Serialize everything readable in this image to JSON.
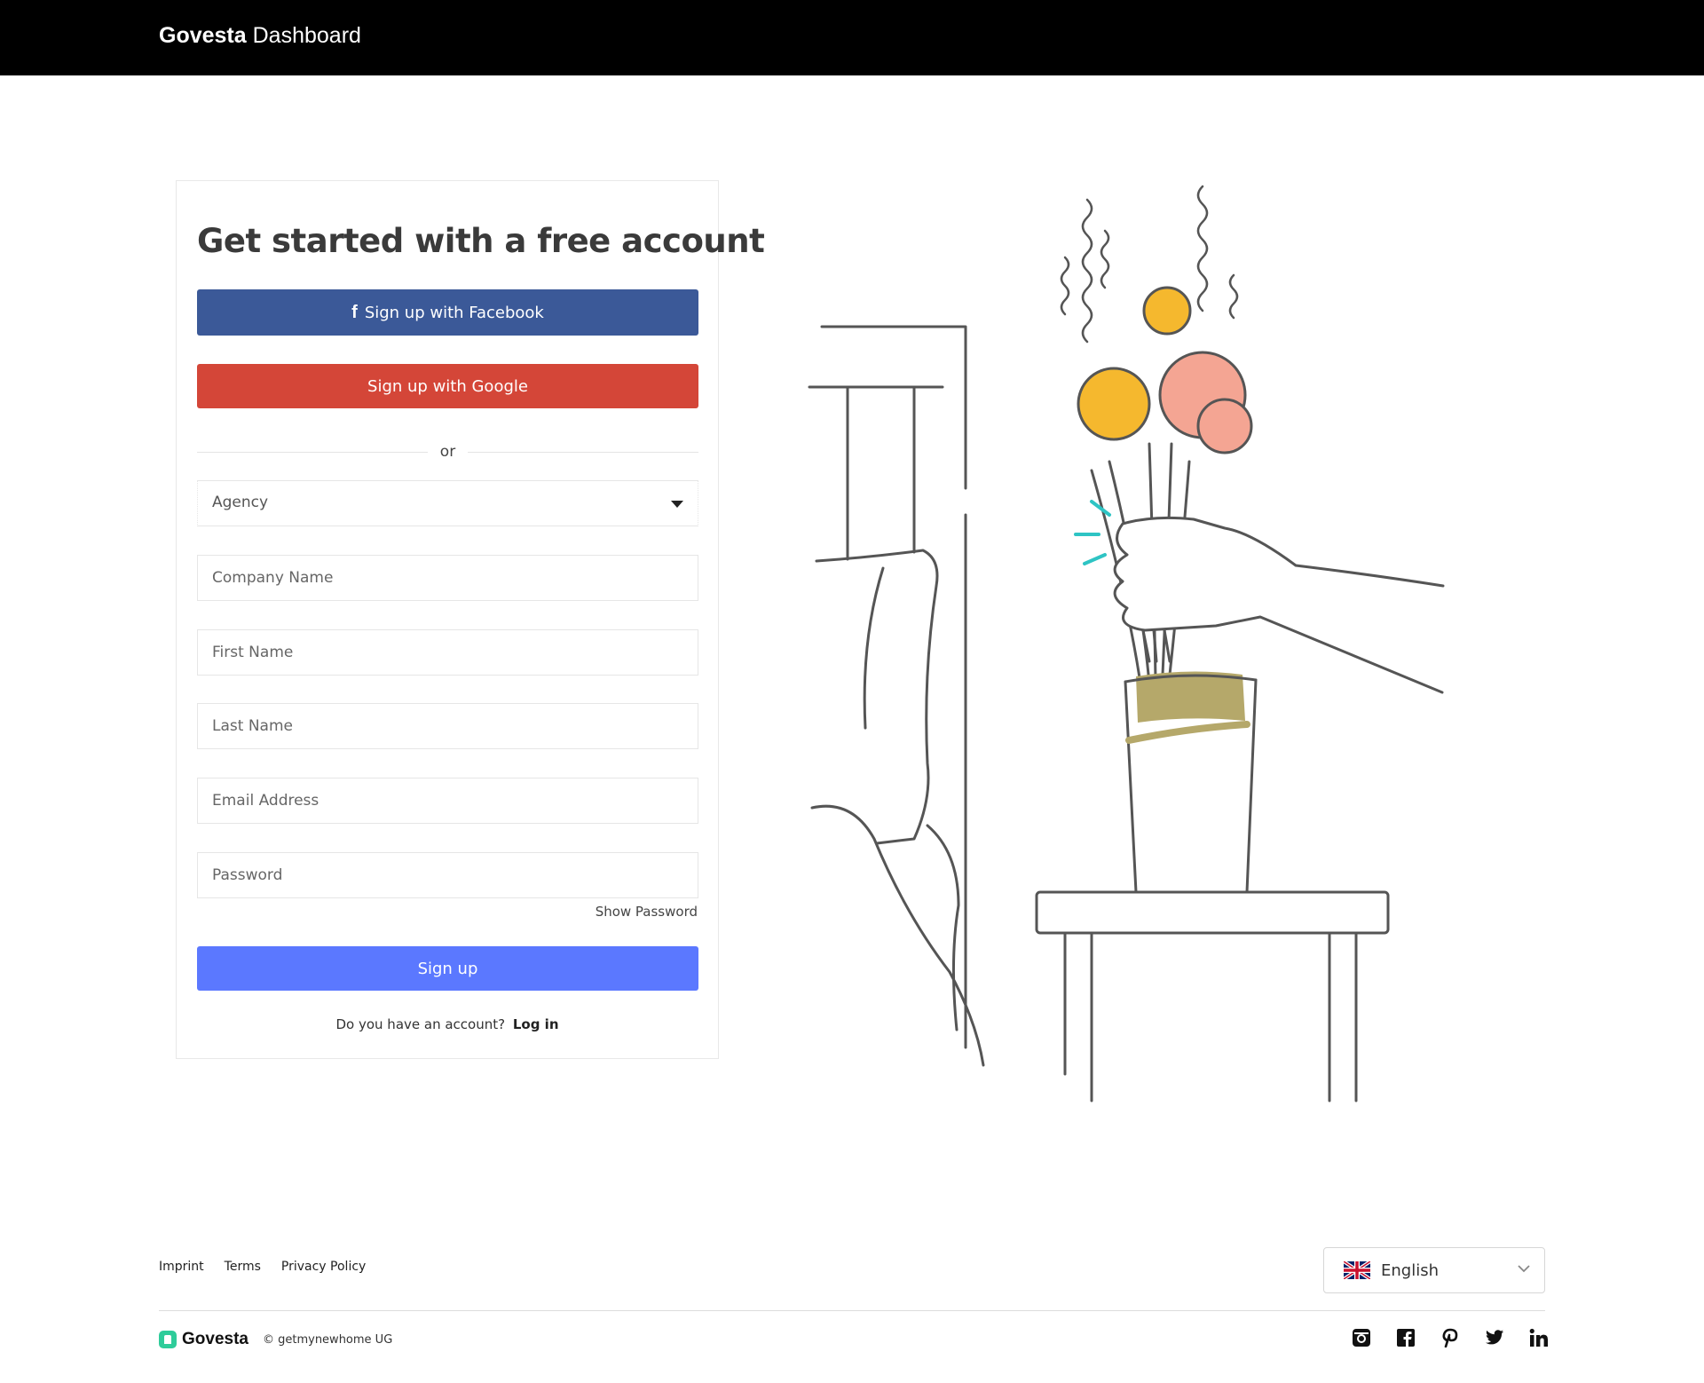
{
  "header": {
    "brand_name": "Govesta",
    "brand_suffix": "Dashboard"
  },
  "signup": {
    "title": "Get started with a free account",
    "facebook_label": "Sign up with Facebook",
    "facebook_icon": "facebook-icon",
    "google_label": "Sign up with Google",
    "divider_text": "or",
    "account_type": {
      "selected": "Agency",
      "options": [
        "Agency"
      ]
    },
    "fields": {
      "company_placeholder": "Company Name",
      "first_name_placeholder": "First Name",
      "last_name_placeholder": "Last Name",
      "email_placeholder": "Email Address",
      "password_placeholder": "Password"
    },
    "show_password_label": "Show Password",
    "submit_label": "Sign up",
    "login_prompt": "Do you have an account?",
    "login_link": "Log in"
  },
  "footer": {
    "links": [
      "Imprint",
      "Terms",
      "Privacy Policy"
    ],
    "language": {
      "label": "English",
      "flag": "uk-flag-icon"
    },
    "brand_name": "Govesta",
    "copyright": "© getmynewhome UG",
    "socials": [
      "instagram-icon",
      "facebook-icon",
      "pinterest-icon",
      "twitter-icon",
      "linkedin-icon"
    ]
  },
  "colors": {
    "header_bg": "#000000",
    "facebook": "#3b5998",
    "google": "#d44638",
    "primary": "#5b78ff",
    "brand_green": "#2ecc9a",
    "illustration_line": "#555555",
    "flower_orange": "#f5b82e",
    "flower_pink": "#f4a593",
    "vase_band": "#b5a86a",
    "accent_teal": "#2ec4c4"
  }
}
